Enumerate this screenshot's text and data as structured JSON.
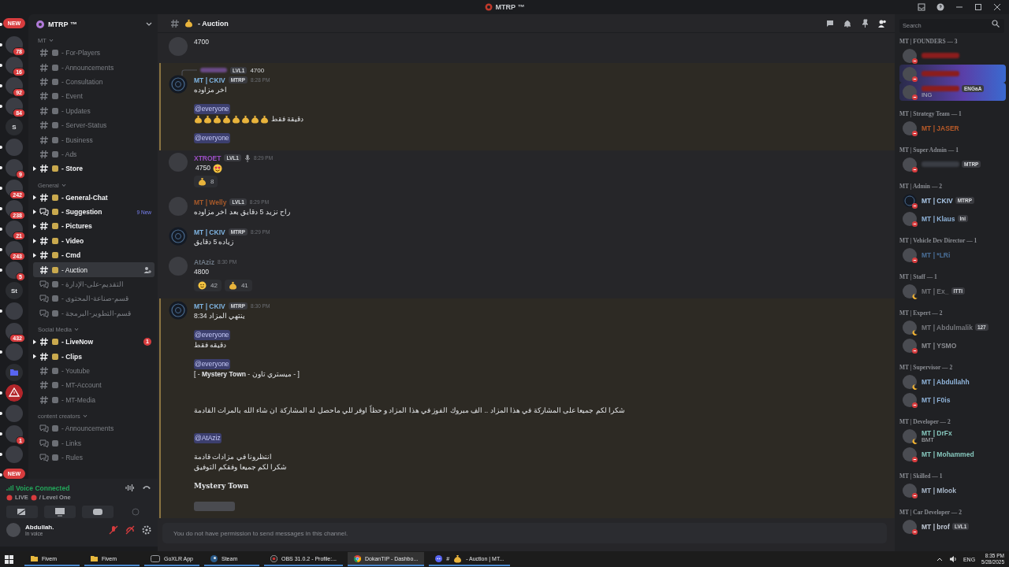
{
  "window": {
    "title": "MTRP ™"
  },
  "servers": [
    {
      "kind": "new",
      "label": "NEW",
      "unread": true
    },
    {
      "kind": "icon",
      "badge": "78",
      "unread": true
    },
    {
      "kind": "icon",
      "badge": "16",
      "unread": true
    },
    {
      "kind": "icon",
      "badge": "92",
      "unread": true
    },
    {
      "kind": "icon",
      "badge": "84",
      "unread": true
    },
    {
      "kind": "text",
      "label": "S",
      "unread": false
    },
    {
      "kind": "icon",
      "unread": true
    },
    {
      "kind": "icon",
      "badge": "9",
      "unread": true
    },
    {
      "kind": "icon",
      "badge": "242",
      "unread": true
    },
    {
      "kind": "icon",
      "badge": "238",
      "unread": true
    },
    {
      "kind": "icon",
      "badge": "21",
      "unread": true
    },
    {
      "kind": "icon",
      "badge": "243",
      "unread": true
    },
    {
      "kind": "icon",
      "badge": "5",
      "unread": true
    },
    {
      "kind": "text",
      "label": "St",
      "unread": false
    },
    {
      "kind": "icon",
      "unread": true
    },
    {
      "kind": "icon",
      "badge": "432",
      "unread": false
    },
    {
      "kind": "icon",
      "unread": true
    },
    {
      "kind": "folder",
      "unread": false
    },
    {
      "kind": "warning",
      "unread": true
    },
    {
      "kind": "icon",
      "unread": true
    },
    {
      "kind": "icon",
      "badge": "1",
      "unread": true
    },
    {
      "kind": "icon",
      "unread": true
    },
    {
      "kind": "new",
      "label": "NEW",
      "unread": true
    }
  ],
  "server": {
    "name": "MTRP ™"
  },
  "categories": [
    {
      "name": "MT",
      "channels": [
        {
          "kind": "text",
          "name": "- For-Players",
          "unread": false,
          "selected": false
        },
        {
          "kind": "text",
          "name": "- Announcements",
          "unread": false,
          "selected": false
        },
        {
          "kind": "text",
          "name": "- Consultation",
          "unread": false,
          "selected": false
        },
        {
          "kind": "text",
          "name": "- Event",
          "unread": false,
          "selected": false
        },
        {
          "kind": "text",
          "name": "- Updates",
          "unread": false,
          "selected": false
        },
        {
          "kind": "text",
          "name": "- Server-Status",
          "unread": false,
          "selected": false
        },
        {
          "kind": "text",
          "name": "- Business",
          "unread": false,
          "selected": false
        },
        {
          "kind": "text",
          "name": "- Ads",
          "unread": false,
          "selected": false
        },
        {
          "kind": "text",
          "name": "- Store",
          "unread": true,
          "selected": false
        }
      ]
    },
    {
      "name": "General",
      "channels": [
        {
          "kind": "text",
          "name": "- General-Chat",
          "unread": true,
          "selected": false
        },
        {
          "kind": "forum",
          "name": "- Suggestion",
          "unread": true,
          "selected": false,
          "badge": "9 New"
        },
        {
          "kind": "text",
          "name": "- Pictures",
          "unread": true,
          "selected": false
        },
        {
          "kind": "text",
          "name": "- Video",
          "unread": true,
          "selected": false
        },
        {
          "kind": "text",
          "name": "- Cmd",
          "unread": true,
          "selected": false
        },
        {
          "kind": "text",
          "name": "- Auction",
          "unread": false,
          "selected": true
        },
        {
          "kind": "forum",
          "name": "- التقديم-على-الإدارة",
          "unread": false,
          "selected": false
        },
        {
          "kind": "forum",
          "name": "- قسم-صناعة-المحتوى",
          "unread": false,
          "selected": false
        },
        {
          "kind": "forum",
          "name": "- قسم-التطوير-البرمجة",
          "unread": false,
          "selected": false
        }
      ]
    },
    {
      "name": "Social Media",
      "channels": [
        {
          "kind": "text",
          "name": "- LiveNow",
          "unread": true,
          "selected": false,
          "mentions": "1"
        },
        {
          "kind": "text",
          "name": "- Clips",
          "unread": true,
          "selected": false
        },
        {
          "kind": "text",
          "name": "- Youtube",
          "unread": false,
          "selected": false
        },
        {
          "kind": "text",
          "name": "- MT-Account",
          "unread": false,
          "selected": false
        },
        {
          "kind": "text",
          "name": "- MT-Media",
          "unread": false,
          "selected": false
        }
      ]
    },
    {
      "name": "content creators",
      "channels": [
        {
          "kind": "forum",
          "name": "- Announcements",
          "unread": false,
          "selected": false
        },
        {
          "kind": "forum",
          "name": "- Links",
          "unread": false,
          "selected": false
        },
        {
          "kind": "forum",
          "name": "- Rules",
          "unread": false,
          "selected": false
        }
      ]
    }
  ],
  "voice": {
    "status": "Voice Connected",
    "live": "LIVE",
    "channel": "/ Level One"
  },
  "user": {
    "name": "Abdullah.",
    "status": "In voice",
    "muted": true,
    "deafened": true
  },
  "channel_header": {
    "name": "- Auction"
  },
  "messages": [
    {
      "avatar": {
        "kind": "photo"
      },
      "highlighted": false,
      "blocks": [
        {
          "kind": "text",
          "text": "4700"
        }
      ]
    },
    {
      "avatar": {
        "kind": "logo"
      },
      "highlighted": true,
      "reply": {
        "badge": "LVL1",
        "text": "4700"
      },
      "author": "MT | CKIV",
      "color": "#7eb3e0",
      "badge": "MTRP",
      "time": "8:28 PM",
      "blocks": [
        {
          "kind": "text",
          "text": "اخر مزاوده"
        },
        {
          "kind": "gap"
        },
        {
          "kind": "mention",
          "text": "@everyone"
        },
        {
          "kind": "emoji_text",
          "emojis": [
            {
              "kind": "money-bag"
            },
            {
              "kind": "money-bag"
            },
            {
              "kind": "money-bag"
            },
            {
              "kind": "money-bag"
            },
            {
              "kind": "money-bag"
            },
            {
              "kind": "money-bag"
            },
            {
              "kind": "money-bag"
            },
            {
              "kind": "money-bag"
            }
          ],
          "text": "دقيقة فقط"
        },
        {
          "kind": "gap"
        },
        {
          "kind": "mention",
          "text": "@everyone"
        }
      ]
    },
    {
      "avatar": {
        "kind": "photo"
      },
      "highlighted": false,
      "author": "XTROET",
      "color": "#9b4fc4",
      "badge": "LVL1",
      "in_voice": true,
      "time": "8:29 PM",
      "blocks": [
        {
          "kind": "text_emoji",
          "text": "4750",
          "emojis": [
            {
              "kind": "heart-eyes"
            }
          ]
        }
      ],
      "reactions": [
        {
          "emoji": {
            "kind": "money-bag"
          },
          "count": "8"
        }
      ]
    },
    {
      "avatar": {
        "kind": "photo"
      },
      "highlighted": false,
      "author": "MT | Welly",
      "color": "#a85a2a",
      "badge": "LVL1",
      "time": "8:29 PM",
      "blocks": [
        {
          "kind": "text",
          "text": "راح نزيد 5 دقايق بعد اخر مزاوده"
        }
      ]
    },
    {
      "avatar": {
        "kind": "logo"
      },
      "highlighted": false,
      "author": "MT | CKIV",
      "color": "#7eb3e0",
      "badge": "MTRP",
      "time": "8:29 PM",
      "blocks": [
        {
          "kind": "text",
          "text": "زياده 5 دقايق"
        }
      ]
    },
    {
      "avatar": {
        "kind": "photo"
      },
      "highlighted": false,
      "author": "AtAziz",
      "color": "#6f7a86",
      "time": "8:30 PM",
      "blocks": [
        {
          "kind": "text",
          "text": "4800"
        }
      ],
      "reactions": [
        {
          "emoji": {
            "kind": "face"
          },
          "count": "42"
        },
        {
          "emoji": {
            "kind": "money-bag"
          },
          "count": "41"
        }
      ]
    },
    {
      "avatar": {
        "kind": "logo"
      },
      "highlighted": true,
      "author": "MT | CKIV",
      "color": "#7eb3e0",
      "badge": "MTRP",
      "time": "8:30 PM",
      "blocks": [
        {
          "kind": "text",
          "text": "ينتهي المزاد 8:34"
        },
        {
          "kind": "gap"
        },
        {
          "kind": "mention",
          "text": "@everyone"
        },
        {
          "kind": "text",
          "text": "دقيقه فقط"
        },
        {
          "kind": "gap"
        },
        {
          "kind": "mention",
          "text": "@everyone"
        },
        {
          "kind": "rich",
          "text": "[ - **Mystery Town** - ميستري تاون - ]"
        },
        {
          "kind": "gap"
        },
        {
          "kind": "gap"
        },
        {
          "kind": "gap"
        },
        {
          "kind": "text",
          "text": "شكرا لكم جميعا على المشاركة في هذا المزاد .. الف مبروك الفوز في هذا المزاد و حظاً اوفر للي ماحصل له المشاركة ان شاء الله بالمرات القادمة"
        },
        {
          "kind": "gap"
        },
        {
          "kind": "gap"
        },
        {
          "kind": "mention",
          "text": "@AtAziz"
        },
        {
          "kind": "gap"
        },
        {
          "kind": "text",
          "text": "انتظرونا في مزادات قادمة"
        },
        {
          "kind": "text",
          "text": "شكرا لكم جميعا وفقكم التوفيق"
        },
        {
          "kind": "gap"
        },
        {
          "kind": "bold",
          "text": "Mystery Town"
        },
        {
          "kind": "gap"
        },
        {
          "kind": "attachment"
        }
      ]
    }
  ],
  "composer": {
    "placeholder": "You do not have permission to send messages in this channel."
  },
  "search": {
    "placeholder": "Search"
  },
  "member_groups": [
    {
      "title": "MT | FOUNDERS — 3",
      "members": [
        {
          "color": "#8b1d1d",
          "status": {
            "kind": "dnd"
          },
          "banner": false
        },
        {
          "color": "#8b1d1d",
          "status": {
            "kind": "dnd"
          },
          "banner": true
        },
        {
          "color": "#8b1d1d",
          "status": {
            "kind": "dnd"
          },
          "banner": true,
          "badge": "ENGaA",
          "activity": "ING"
        }
      ]
    },
    {
      "title": "MT | Strategy Team — 1",
      "members": [
        {
          "name": "MT | JASER",
          "color": "#b85a28",
          "status": {
            "kind": "dnd"
          }
        }
      ]
    },
    {
      "title": "MT | Super Admin — 1",
      "members": [
        {
          "color": "#3a3d44",
          "status": {
            "kind": "dnd"
          },
          "badge": "MTRP"
        }
      ]
    },
    {
      "title": "MT | Admin — 2",
      "members": [
        {
          "name": "MT | CKIV",
          "color": "#a9c6e6",
          "status": {
            "kind": "dnd"
          },
          "badge": "MTRP",
          "avatar": {
            "kind": "logo"
          }
        },
        {
          "name": "MT | Klaus",
          "color": "#8fb3d9",
          "status": {
            "kind": "dnd"
          },
          "badge": "Ini"
        }
      ]
    },
    {
      "title": "MT | Vehicle Dev Director — 1",
      "members": [
        {
          "name": "MT | *LRi",
          "color": "#4a6f98",
          "status": {
            "kind": "dnd"
          }
        }
      ]
    },
    {
      "title": "MT | Staff — 1",
      "members": [
        {
          "name": "MT | Ex_",
          "color": "#6e7075",
          "status": {
            "kind": "idle"
          },
          "badge": "ITTI"
        }
      ]
    },
    {
      "title": "MT | Expert — 2",
      "members": [
        {
          "name": "MT | Abdulmalik",
          "color": "#74767b",
          "status": {
            "kind": "idle"
          },
          "badge": "127"
        },
        {
          "name": "MT | YSMO",
          "color": "#8a8c91",
          "status": {
            "kind": "dnd"
          }
        }
      ]
    },
    {
      "title": "MT | Supervisor — 2",
      "members": [
        {
          "name": "MT | Abdullahh",
          "color": "#8fb3d9",
          "status": {
            "kind": "idle"
          }
        },
        {
          "name": "MT | F0is",
          "color": "#8fb3d9",
          "status": {
            "kind": "dnd"
          }
        }
      ]
    },
    {
      "title": "MT | Developer — 2",
      "members": [
        {
          "name": "MT | DrFx",
          "color": "#86c7bd",
          "status": {
            "kind": "idle"
          },
          "activity": "BMT"
        },
        {
          "name": "MT | Mohammed",
          "color": "#86c7bd",
          "status": {
            "kind": "dnd"
          }
        }
      ]
    },
    {
      "title": "MT | Skilled — 1",
      "members": [
        {
          "name": "MT | Mlook",
          "color": "#a9b8ca",
          "status": {
            "kind": "dnd"
          }
        }
      ]
    },
    {
      "title": "MT | Car Developer — 2",
      "members": [
        {
          "name": "MT | brof",
          "color": "#c3cbd8",
          "status": {
            "kind": "dnd"
          },
          "badge": "LVL1"
        }
      ]
    }
  ],
  "taskbar": {
    "items": [
      {
        "kind": "folder",
        "label": "Fivem",
        "selected": false
      },
      {
        "kind": "folder",
        "label": "Fivem",
        "selected": false
      },
      {
        "kind": "app",
        "label": "GoXLR App",
        "selected": false
      },
      {
        "kind": "steam",
        "label": "Steam",
        "selected": false
      },
      {
        "kind": "obs",
        "label": "OBS 31.0.2 - Profile:...",
        "selected": false
      },
      {
        "kind": "browser",
        "label": "DokanTIP - Dashbo...",
        "selected": true
      },
      {
        "kind": "discord",
        "prefix": "#",
        "label": "- Auction | MT...",
        "selected": false
      }
    ],
    "language": "ENG",
    "time": "8:35 PM",
    "date": "5/28/2025"
  }
}
